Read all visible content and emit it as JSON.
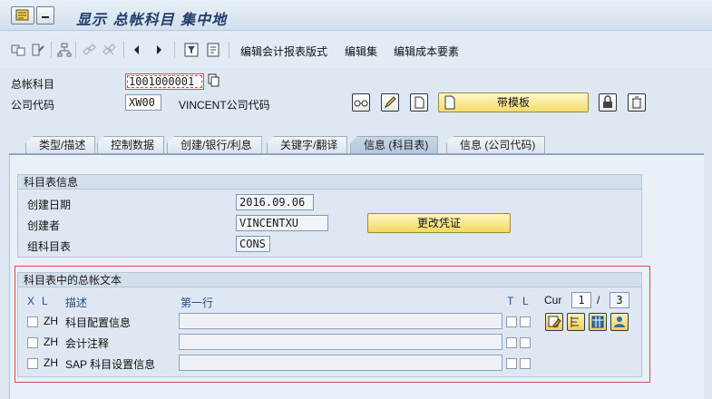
{
  "window": {
    "title": "显示 总帐科目 集中地"
  },
  "toolbar": {
    "items": [
      "编辑会计报表版式",
      "编辑集",
      "编辑成本要素"
    ]
  },
  "header": {
    "gl_account_label": "总帐科目",
    "gl_account_value": "1001000001",
    "company_code_label": "公司代码",
    "company_code_value": "XW00",
    "company_code_name": "VINCENT公司代码",
    "template_button": "带模板"
  },
  "tabs": [
    {
      "label": "类型/描述",
      "active": false
    },
    {
      "label": "控制数据",
      "active": false
    },
    {
      "label": "创建/银行/利息",
      "active": false
    },
    {
      "label": "关键字/翻译",
      "active": false
    },
    {
      "label": "信息 (科目表)",
      "active": true
    },
    {
      "label": "信息 (公司代码)",
      "active": false
    }
  ],
  "coa_info": {
    "title": "科目表信息",
    "created_on_label": "创建日期",
    "created_on_value": "2016.09.06",
    "created_by_label": "创建者",
    "created_by_value": "VINCENTXU",
    "group_chart_label": "组科目表",
    "group_chart_value": "CONS",
    "change_button": "更改凭证"
  },
  "texts": {
    "title": "科目表中的总帐文本",
    "col_x": "X",
    "col_l": "L",
    "col_desc": "描述",
    "col_first_line": "第一行",
    "col_t": "T",
    "col_l2": "L",
    "cur_label": "Cur",
    "cur_value": "1",
    "slash": "/",
    "cur_total": "3",
    "rows": [
      {
        "lang": "ZH",
        "desc": "科目配置信息"
      },
      {
        "lang": "ZH",
        "desc": "会计注释"
      },
      {
        "lang": "ZH",
        "desc": "SAP 科目设置信息"
      }
    ]
  },
  "colors": {
    "accent": "#203d6b",
    "highlight_frame": "#d94a4a",
    "button_yellow": "#f4d862"
  }
}
